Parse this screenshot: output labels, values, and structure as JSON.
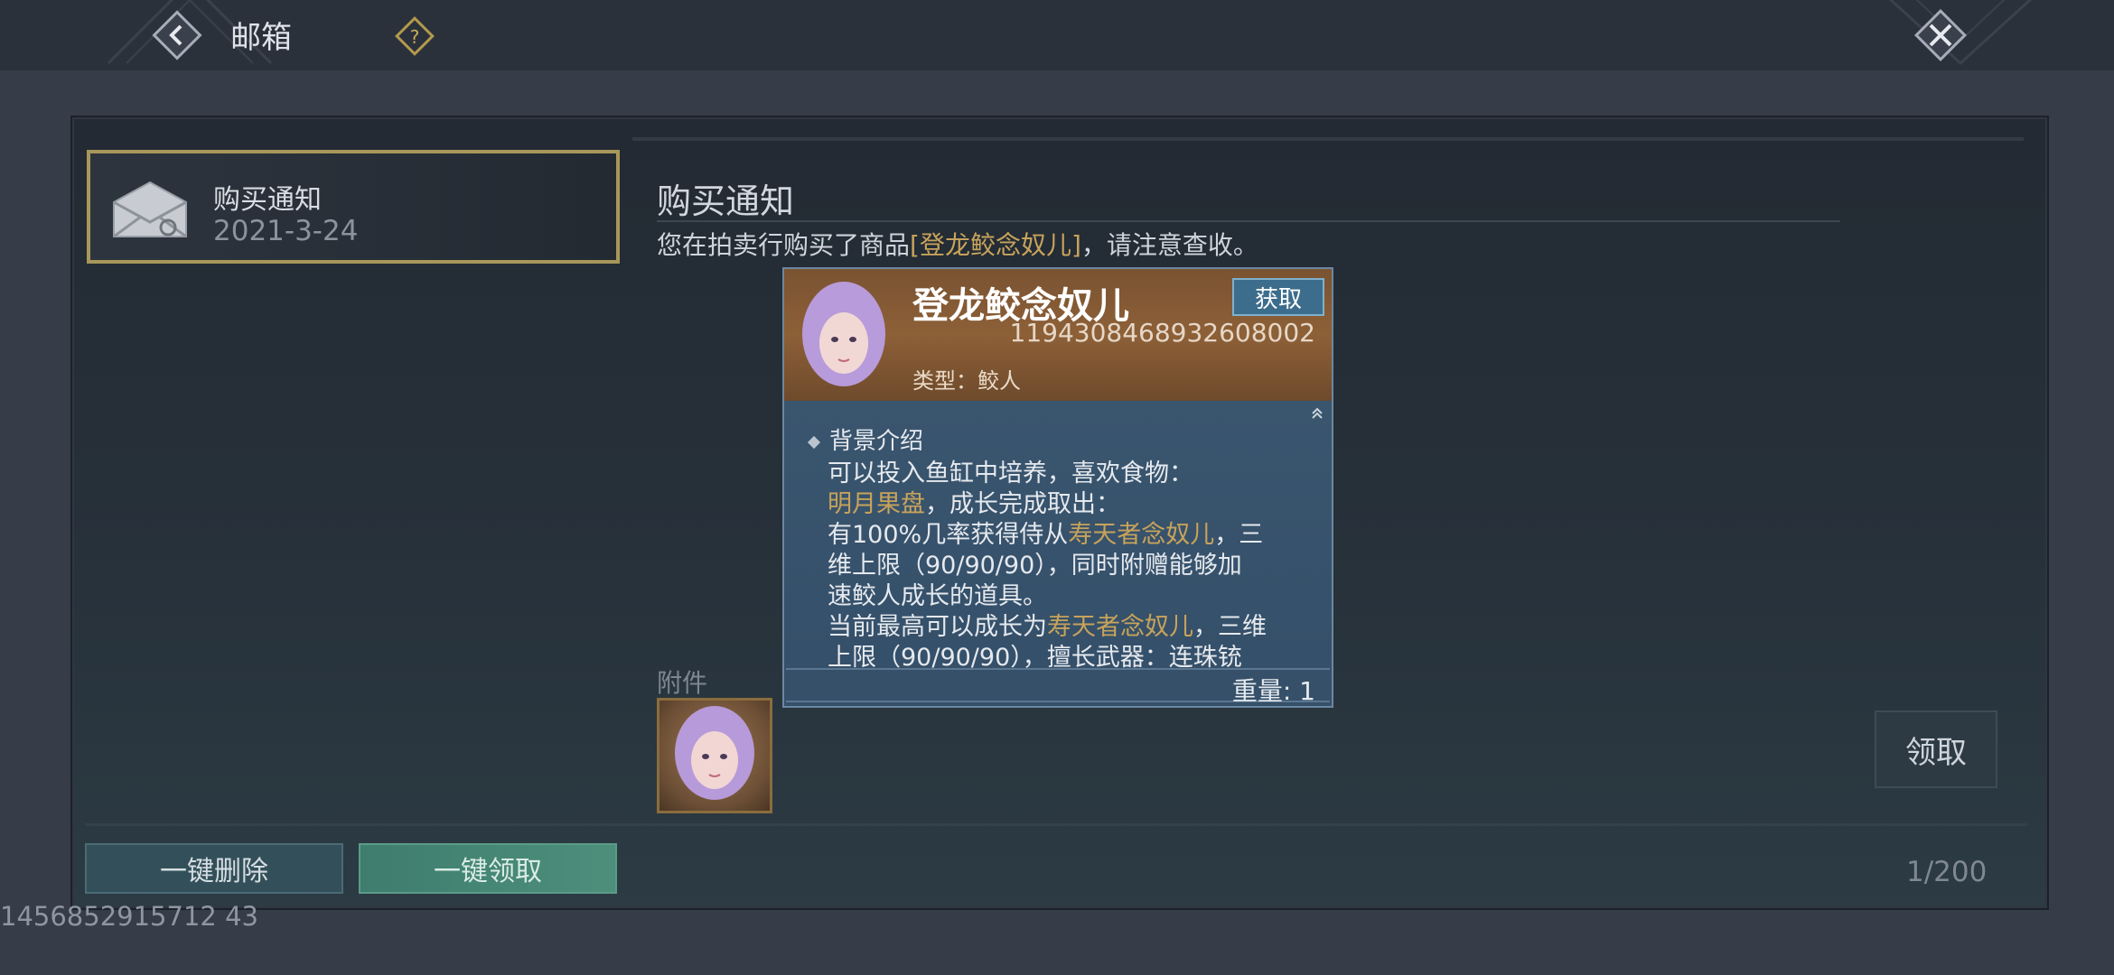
{
  "header": {
    "title": "邮箱"
  },
  "mail_list": [
    {
      "title": "购买通知",
      "date": "2021-3-24"
    }
  ],
  "detail": {
    "title": "购买通知",
    "text_prefix": "您在拍卖行购买了商品",
    "item_link": "[登龙鲛念奴儿]",
    "text_suffix": "，请注意查收。",
    "attachment_label": "附件",
    "claim_label": "领取"
  },
  "tooltip": {
    "name": "登龙鲛念奴儿",
    "get_label": "获取",
    "id": "1194308468932608002",
    "type": "类型：鲛人",
    "section": "背景介绍",
    "line1": "可以投入鱼缸中培养，喜欢食物：",
    "line2_gold": "明月果盘",
    "line2_rest": "，成长完成取出：",
    "line3_a": "有100%几率获得侍从",
    "line3_gold": "寿天者念奴儿",
    "line3_b": "，三",
    "line4": "维上限（90/90/90），同时附赠能够加",
    "line5": "速鲛人成长的道具。",
    "line6_a": "当前最高可以成长为",
    "line6_gold": "寿天者念奴儿",
    "line6_b": "，三维",
    "line7": "上限（90/90/90），擅长武器：连珠铳",
    "weight": "重量: 1"
  },
  "footer": {
    "delete_all": "一键删除",
    "claim_all": "一键领取",
    "count": "1/200"
  },
  "uid": "1456852915712 43",
  "colors": {
    "accent_gold": "#c7a35b",
    "selected_border": "#a8975a",
    "claim_all_bg": "#4c8f7b"
  },
  "icons": [
    "back-arrow-icon",
    "help-icon",
    "close-icon",
    "mail-icon",
    "portrait-icon",
    "scroll-up-icon"
  ]
}
